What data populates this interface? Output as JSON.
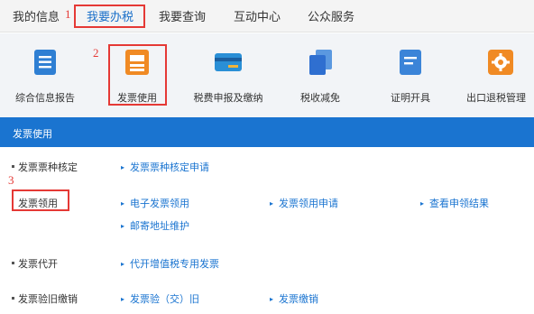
{
  "nav": {
    "items": [
      "我的信息",
      "我要办税",
      "我要查询",
      "互动中心",
      "公众服务"
    ]
  },
  "marks": [
    "1",
    "2",
    "3"
  ],
  "tiles": [
    {
      "label": "综合信息报告",
      "icon": "report-icon",
      "color": "#2f7fd3"
    },
    {
      "label": "发票使用",
      "icon": "invoice-icon",
      "color": "#f08a24"
    },
    {
      "label": "税费申报及缴纳",
      "icon": "card-icon",
      "color": "#2a8fd6"
    },
    {
      "label": "税收减免",
      "icon": "documents-icon",
      "color": "#2f6fd0"
    },
    {
      "label": "证明开具",
      "icon": "certificate-icon",
      "color": "#3b84d8"
    },
    {
      "label": "出口退税管理",
      "icon": "gear-icon",
      "color": "#f08a24"
    }
  ],
  "panel": {
    "title": "发票使用",
    "rows": [
      {
        "label": "发票票种核定",
        "links": [
          "发票票种核定申请"
        ]
      },
      {
        "label": "发票领用",
        "links": [
          "电子发票领用",
          "发票领用申请",
          "查看申领结果",
          "邮寄地址维护"
        ]
      },
      {
        "label": "发票代开",
        "links": [
          "代开增值税专用发票"
        ]
      },
      {
        "label": "发票验旧缴销",
        "links": [
          "发票验（交）旧",
          "发票缴销"
        ]
      }
    ]
  }
}
